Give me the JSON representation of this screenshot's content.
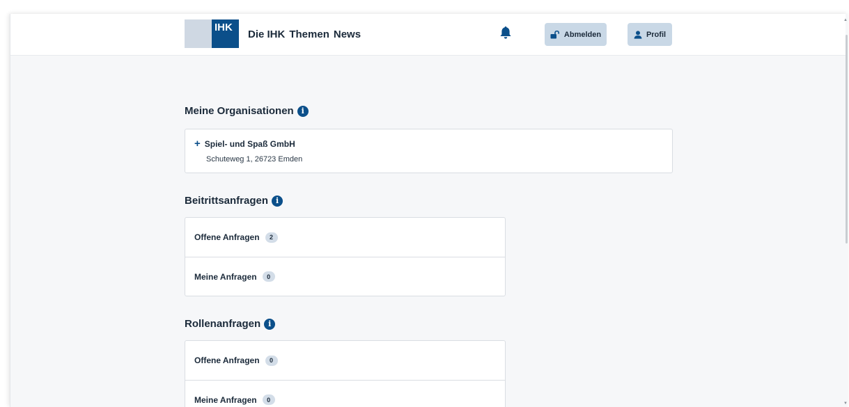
{
  "header": {
    "logo_text": "IHK",
    "nav": [
      "Die IHK",
      "Themen",
      "News"
    ],
    "logout_label": "Abmelden",
    "profile_label": "Profil"
  },
  "organizations": {
    "title": "Meine Organisationen",
    "items": [
      {
        "name": "Spiel- und Spaß GmbH",
        "address": "Schuteweg 1, 26723 Emden"
      }
    ]
  },
  "join_requests": {
    "title": "Beitrittsanfragen",
    "open_label": "Offene Anfragen",
    "open_count": "2",
    "mine_label": "Meine Anfragen",
    "mine_count": "0"
  },
  "role_requests": {
    "title": "Rollenanfragen",
    "open_label": "Offene Anfragen",
    "open_count": "0",
    "mine_label": "Meine Anfragen",
    "mine_count": "0"
  },
  "colors": {
    "brand": "#0b4f8a",
    "button_bg": "#c9d8e6",
    "badge_bg": "#d3dde8",
    "page_bg": "#f6f7f9"
  }
}
